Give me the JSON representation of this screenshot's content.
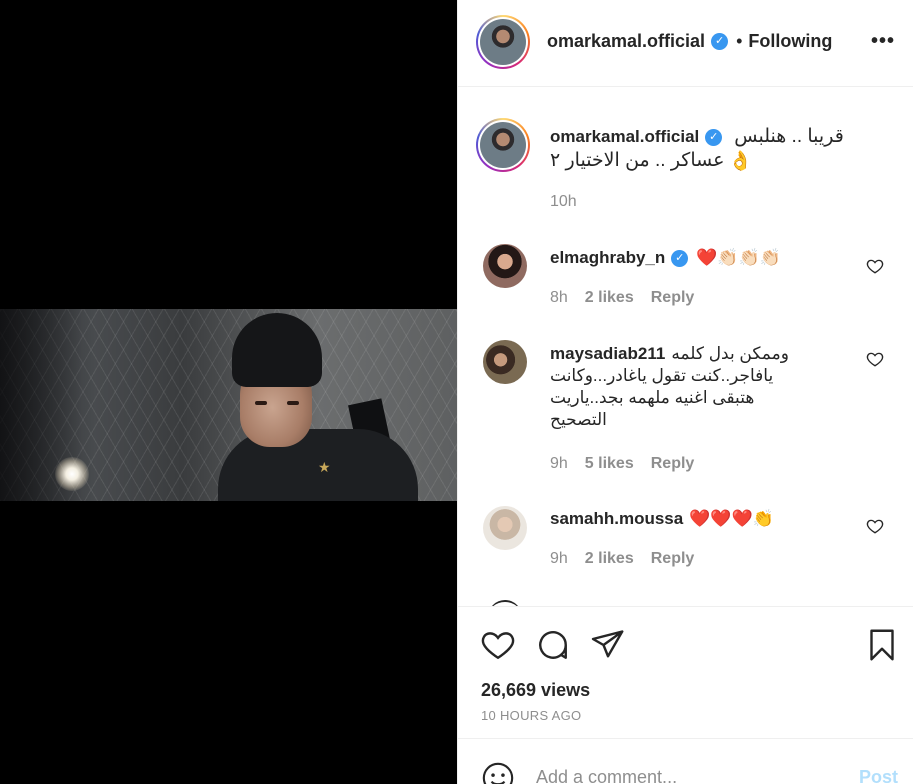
{
  "post": {
    "username": "omarkamal.official",
    "following_label": "Following",
    "more_label": "•••",
    "caption_line1": "قريبا .. هنلبس",
    "caption_line2": "عساكر .. من الاختيار ٢",
    "caption_emoji": "👌",
    "caption_time": "10h",
    "views": "26,669 views",
    "time_ago": "10 HOURS AGO"
  },
  "comments": [
    {
      "username": "elmaghraby_n",
      "verified": true,
      "text": "❤️👏🏻👏🏻👏🏻",
      "time": "8h",
      "likes": "2 likes",
      "reply": "Reply"
    },
    {
      "username": "maysadiab211",
      "verified": false,
      "text_lines": [
        "وممكن بدل كلمه",
        "يافاجر..كنت تقول ياغادر...وكانت",
        "هتبقى اغنيه ملهمه بجد..ياريت",
        "التصحيح"
      ],
      "time": "9h",
      "likes": "5 likes",
      "reply": "Reply"
    },
    {
      "username": "samahh.moussa",
      "verified": false,
      "text": "❤️❤️❤️👏",
      "time": "9h",
      "likes": "2 likes",
      "reply": "Reply"
    }
  ],
  "composer": {
    "placeholder": "Add a comment...",
    "post_label": "Post"
  },
  "colors": {
    "verified": "#3897f0",
    "muted": "#8e8e8e",
    "post_disabled": "#b2dffc",
    "heart": "#ed4956"
  },
  "icons": [
    "heart-icon",
    "comment-icon",
    "share-icon",
    "bookmark-icon",
    "smile-icon",
    "verified-icon"
  ]
}
